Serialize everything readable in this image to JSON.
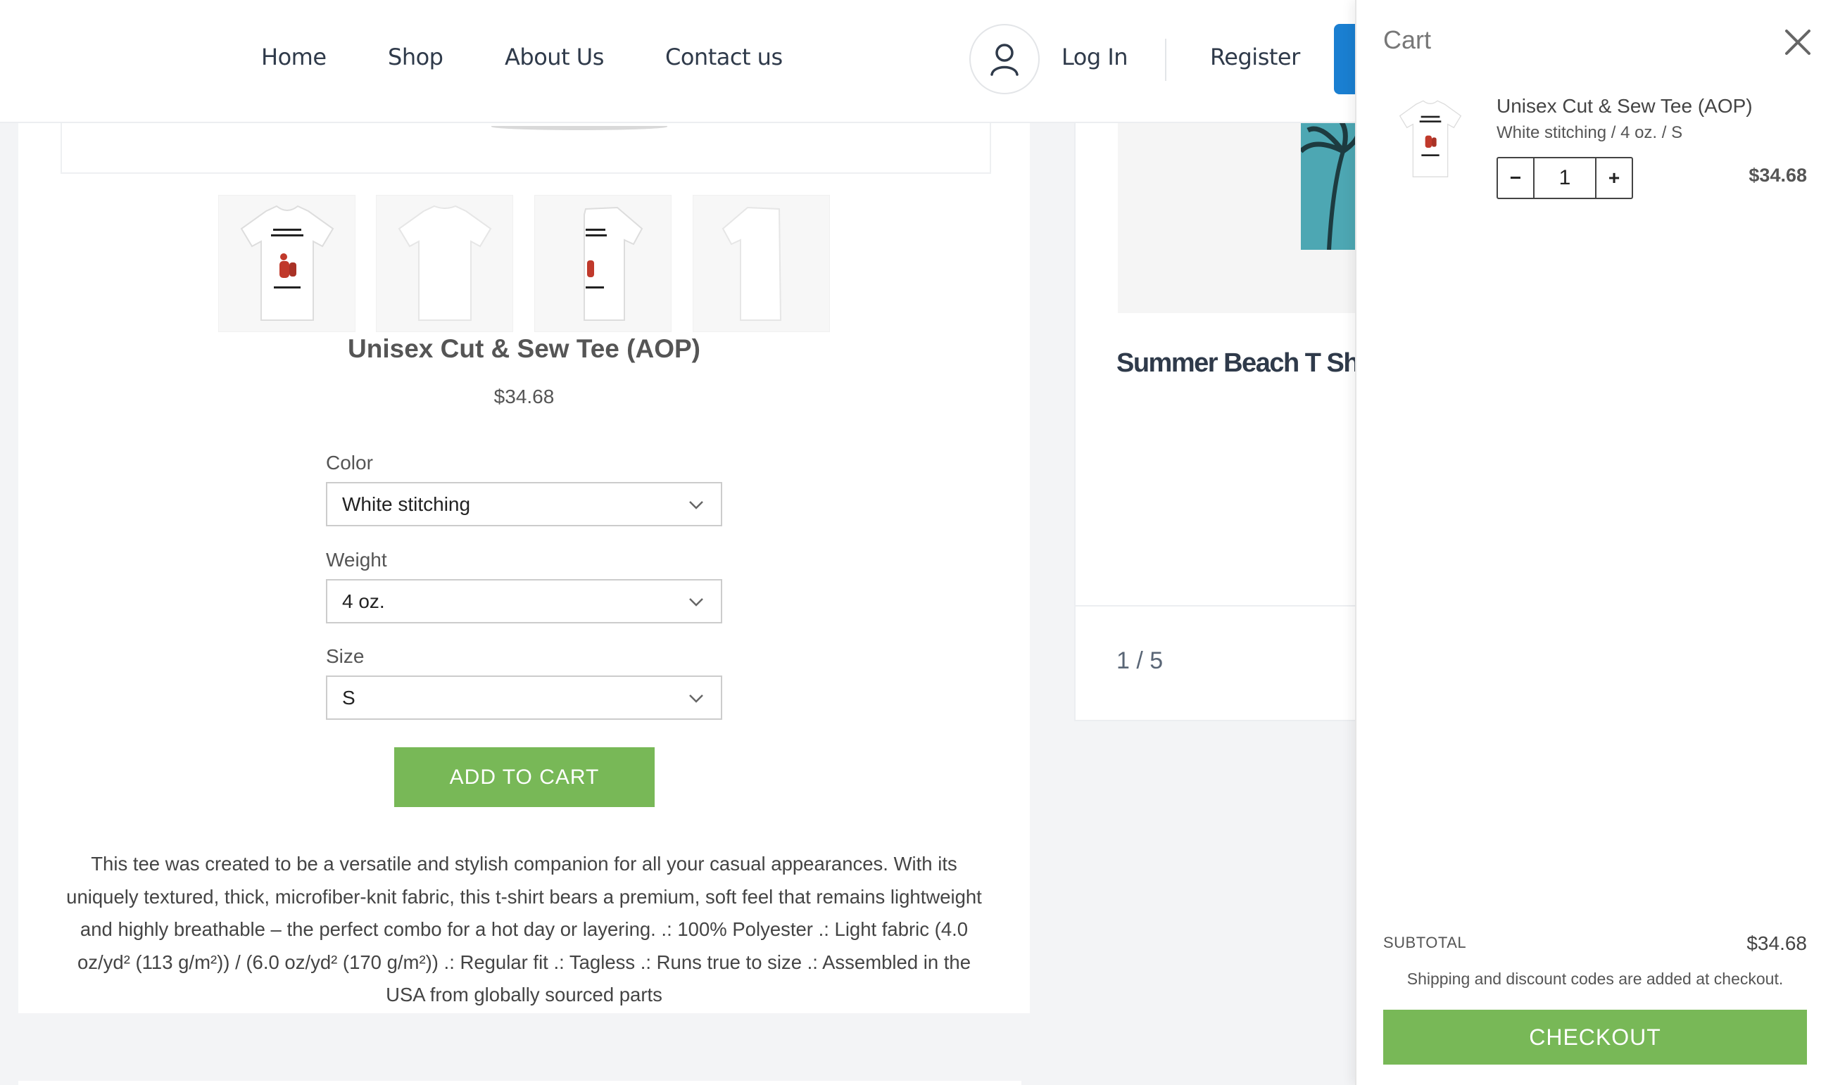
{
  "nav": {
    "items": [
      "Home",
      "Shop",
      "About Us",
      "Contact us"
    ],
    "login": "Log In",
    "register": "Register"
  },
  "product": {
    "title": "Unisex Cut & Sew Tee (AOP)",
    "price": "$34.68",
    "options": [
      {
        "label": "Color",
        "value": "White stitching"
      },
      {
        "label": "Weight",
        "value": "4 oz."
      },
      {
        "label": "Size",
        "value": "S"
      }
    ],
    "add_to_cart": "ADD TO CART",
    "description": "This tee was created to be a versatile and stylish companion for all your casual appearances. With its uniquely textured, thick, microfiber-knit fabric, this t-shirt bears a premium, soft feel that remains lightweight and highly breathable – the perfect combo for a hot day or layering. .: 100% Polyester .: Light fabric (4.0 oz/yd² (113 g/m²)) / (6.0 oz/yd² (170 g/m²)) .: Regular fit .: Tagless .: Runs true to size .: Assembled in the USA from globally sourced parts"
  },
  "related": {
    "title": "Summer Beach T Sh",
    "pager": "1 / 5"
  },
  "cart": {
    "title": "Cart",
    "item": {
      "name": "Unisex Cut & Sew Tee (AOP)",
      "variant": "White stitching / 4 oz. / S",
      "quantity": "1",
      "minus": "−",
      "plus": "+",
      "price": "$34.68"
    },
    "subtotal_label": "SUBTOTAL",
    "subtotal_value": "$34.68",
    "shipping_note": "Shipping and discount codes are added at checkout.",
    "checkout": "CHECKOUT"
  },
  "colors": {
    "green": "#78b857",
    "blue": "#1a7fd1",
    "teal": "#4da7b3"
  }
}
